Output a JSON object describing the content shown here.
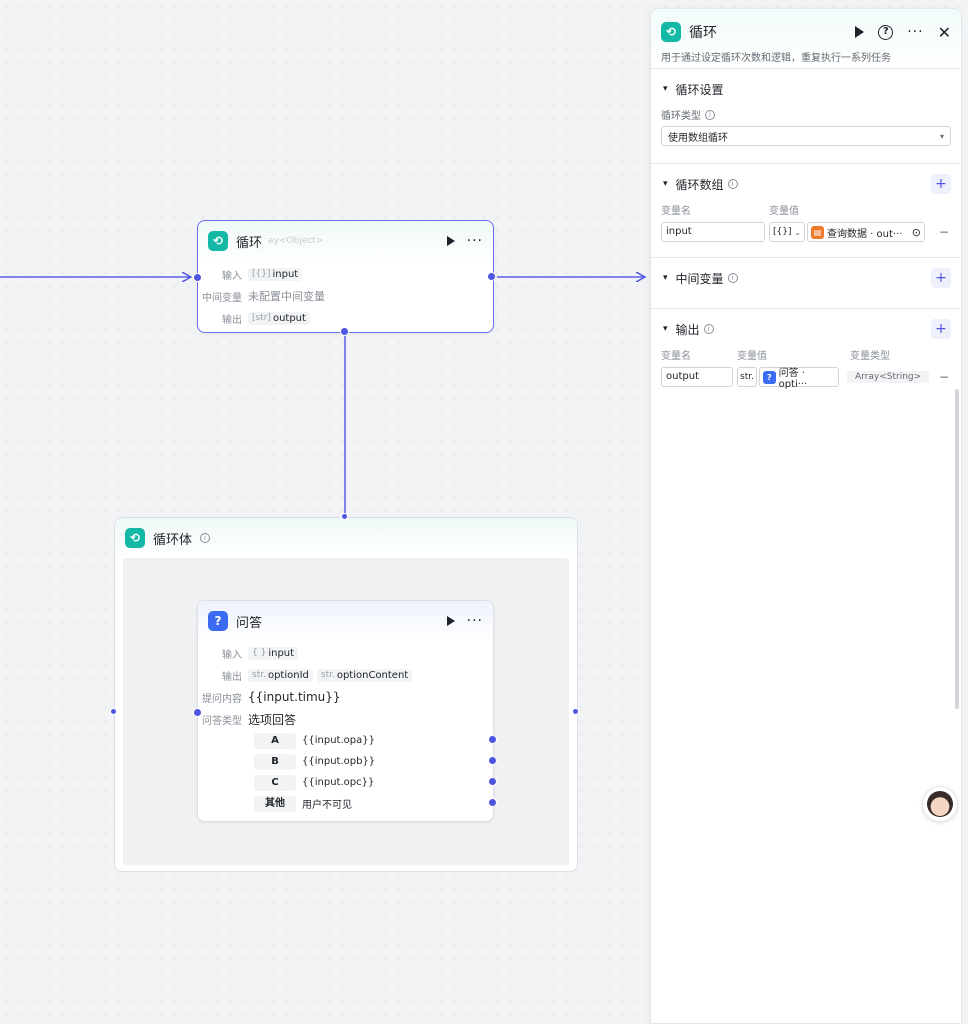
{
  "loop_node": {
    "title": "循环",
    "rows": [
      {
        "label": "输入",
        "prefix": "[{}]",
        "value": "input"
      },
      {
        "label": "中间变量",
        "value": "未配置中间变量"
      },
      {
        "label": "输出",
        "prefix": "[str]",
        "value": "output"
      }
    ],
    "ghost_text": "ay<Object>"
  },
  "loop_body": {
    "title": "循环体"
  },
  "qa_node": {
    "title": "问答",
    "input_label": "输入",
    "input_prefix": "{ }",
    "input_value": "input",
    "output_label": "输出",
    "outputs": [
      {
        "prefix": "str.",
        "value": "optionId"
      },
      {
        "prefix": "str.",
        "value": "optionContent"
      }
    ],
    "question_label": "提问内容",
    "question_value": "{{input.timu}}",
    "answer_type_label": "问答类型",
    "answer_type_value": "选项回答",
    "options": [
      {
        "key": "A",
        "value": "{{input.opa}}"
      },
      {
        "key": "B",
        "value": "{{input.opb}}"
      },
      {
        "key": "C",
        "value": "{{input.opc}}"
      },
      {
        "key": "其他",
        "value": "用户不可见"
      }
    ]
  },
  "panel": {
    "title": "循环",
    "description": "用于通过设定循环次数和逻辑，重复执行一系列任务",
    "loop_settings": {
      "title": "循环设置",
      "type_label": "循环类型",
      "type_value": "使用数组循环"
    },
    "loop_array": {
      "title": "循环数组",
      "col_name": "变量名",
      "col_value": "变量值",
      "var_name": "input",
      "var_type_prefix": "[{}]",
      "ref_value": "查询数据 · out···"
    },
    "mid_vars": {
      "title": "中间变量"
    },
    "output": {
      "title": "输出",
      "col_name": "变量名",
      "col_value": "变量值",
      "col_type": "变量类型",
      "var_name": "output",
      "var_prefix": "str.",
      "ref_value": "问答 · opti···",
      "var_type": "Array<String>"
    }
  },
  "colors": {
    "accent": "#4e55e0",
    "loop_icon": "#14b8a6",
    "qa_icon": "#3b6bf0",
    "db_icon": "#f07a2b"
  }
}
